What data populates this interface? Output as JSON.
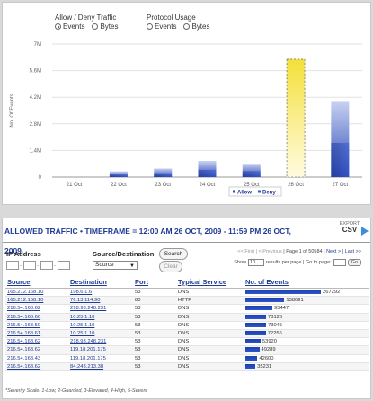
{
  "chart_panel": {
    "traffic_group": {
      "title": "Allow / Deny Traffic",
      "options": [
        "Events",
        "Bytes"
      ],
      "selected": "Events"
    },
    "protocol_group": {
      "title": "Protocol Usage",
      "options": [
        "Events",
        "Bytes"
      ],
      "selected": ""
    }
  },
  "chart_data": {
    "type": "bar",
    "ylabel": "No. Of Events",
    "yticks": [
      "0",
      "1.4M",
      "2.8M",
      "4.2M",
      "5.6M",
      "7M"
    ],
    "ylim": [
      0,
      7000000
    ],
    "categories": [
      "21 Oct",
      "22 Oct",
      "23 Oct",
      "24 Oct",
      "25 Oct",
      "26 Oct",
      "27 Oct"
    ],
    "series": [
      {
        "name": "Allow",
        "values": [
          0,
          300000,
          450000,
          850000,
          700000,
          6200000,
          4000000
        ]
      },
      {
        "name": "Deny",
        "values": [
          0,
          0,
          0,
          0,
          0,
          0,
          0
        ]
      }
    ],
    "highlighted_category": "26 Oct",
    "legend_position": "bottom-right",
    "grid": true,
    "colors": {
      "allow": "#2a48b8",
      "highlight": "#f2e04a"
    }
  },
  "table_panel": {
    "title": "ALLOWED TRAFFIC • TIMEFRAME = 12:00 AM 26 OCT, 2009 - 11:59 PM 26 OCT, 2009",
    "export": {
      "label": "EXPORT",
      "format": "CSV"
    },
    "filters": {
      "ip_label": "IP Address",
      "sd_label": "Source/Destination",
      "sd_selected": "Source",
      "search_label": "Search",
      "clear_label": "Clear"
    },
    "pager": {
      "first": "<< First",
      "previous": "< Previous",
      "page_info": "Page 1 of 50584",
      "next": "Next >",
      "last": "Last >>",
      "show_label": "Show",
      "per_page_value": "10",
      "per_page_suffix": "results per page | Go to page:",
      "go_label": "Go"
    },
    "columns": [
      "Source",
      "Destination",
      "Port",
      "Typical Service",
      "No. of Events"
    ],
    "max_events": 267292,
    "rows": [
      {
        "source": "165.212.168.10",
        "destination": "198.6.1.6",
        "port": "53",
        "service": "DNS",
        "events": 267292
      },
      {
        "source": "165.212.168.10",
        "destination": "76.13.114.90",
        "port": "80",
        "service": "HTTP",
        "events": 138091
      },
      {
        "source": "216.54.168.62",
        "destination": "218.93.248.231",
        "port": "53",
        "service": "DNS",
        "events": 95447
      },
      {
        "source": "216.54.168.60",
        "destination": "10.25.1.10",
        "port": "53",
        "service": "DNS",
        "events": 73126
      },
      {
        "source": "216.54.168.59",
        "destination": "10.25.1.10",
        "port": "53",
        "service": "DNS",
        "events": 73045
      },
      {
        "source": "216.54.168.61",
        "destination": "10.25.1.10",
        "port": "53",
        "service": "DNS",
        "events": 72256
      },
      {
        "source": "216.54.168.62",
        "destination": "218.93.248.231",
        "port": "53",
        "service": "DNS",
        "events": 53920
      },
      {
        "source": "216.54.168.62",
        "destination": "119.18.201.175",
        "port": "53",
        "service": "DNS",
        "events": 49289
      },
      {
        "source": "216.54.168.43",
        "destination": "119.18.201.175",
        "port": "53",
        "service": "DNS",
        "events": 42600
      },
      {
        "source": "216.54.168.62",
        "destination": "84.243.213.38",
        "port": "53",
        "service": "DNS",
        "events": 35231
      }
    ],
    "severity_text": "*Severity Scale: 1-Low, 2-Guarded, 3-Elevated, 4-High, 5-Severe"
  }
}
